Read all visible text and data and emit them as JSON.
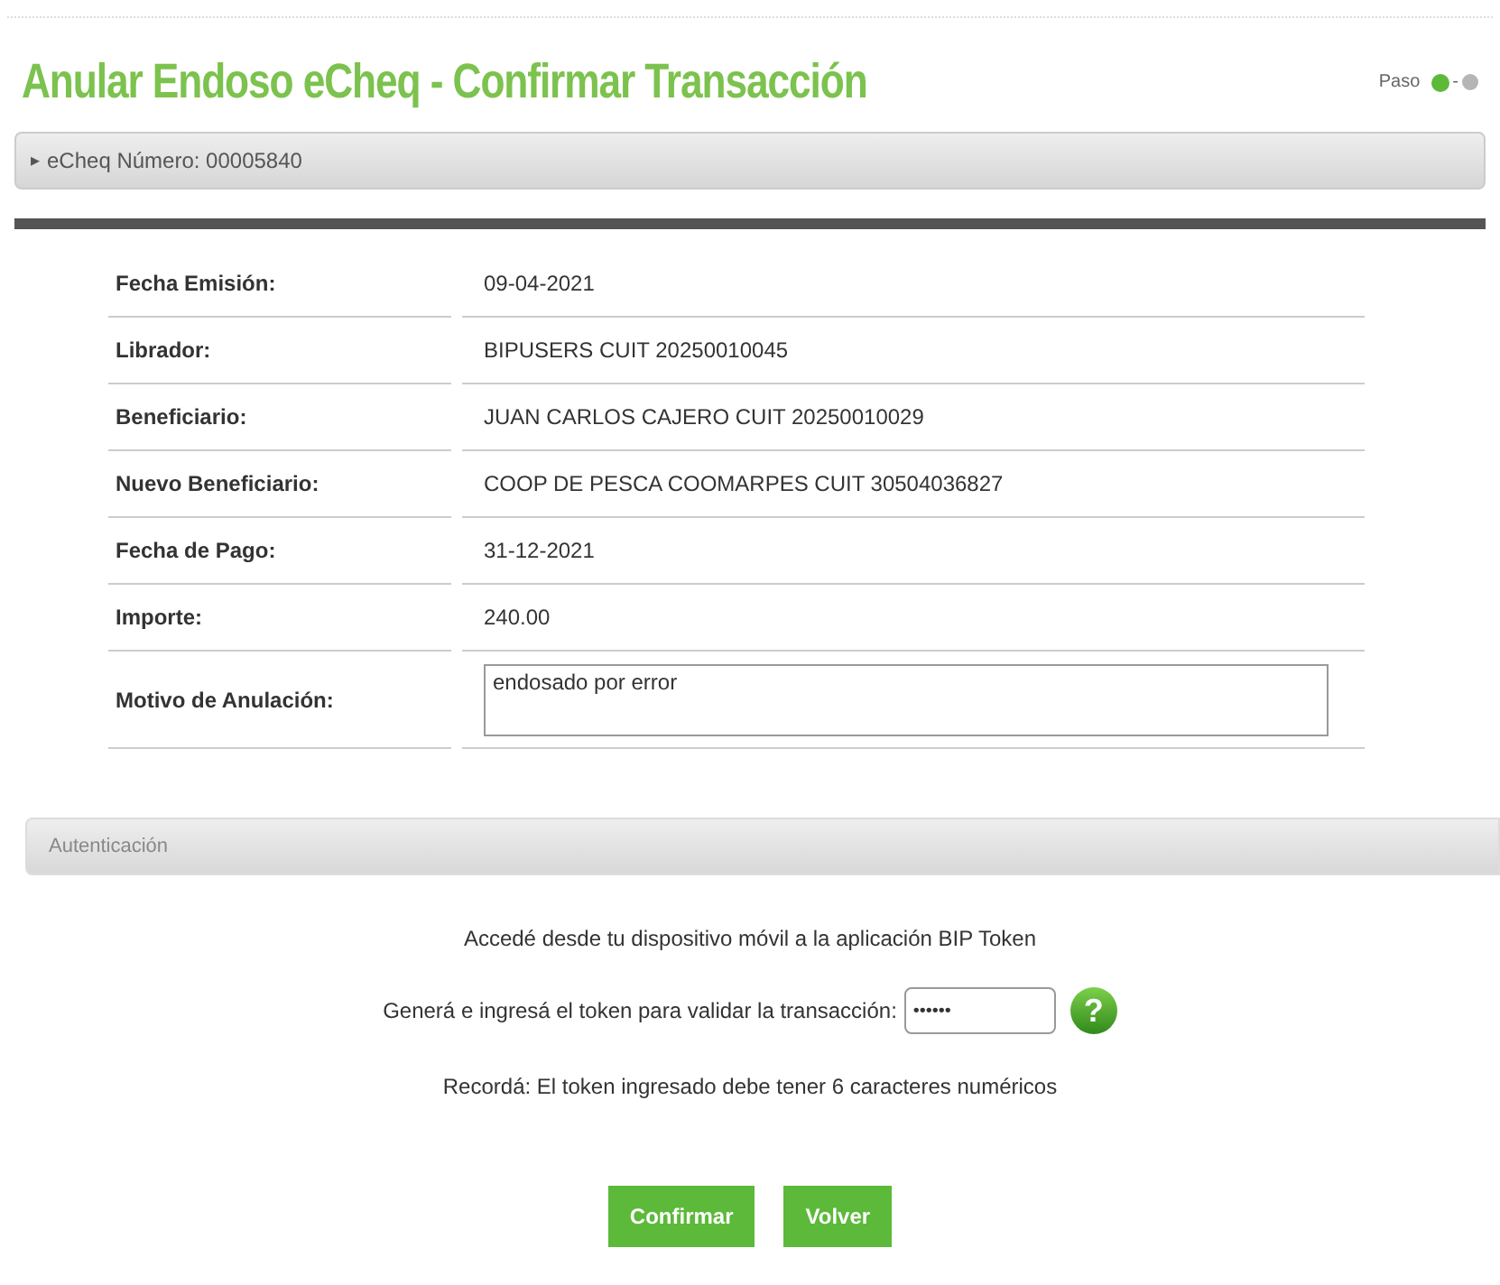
{
  "title": "Anular Endoso eCheq - Confirmar Transacción",
  "steps": {
    "label": "Paso",
    "separator": "-",
    "items": [
      {
        "selected": true
      },
      {
        "selected": false
      }
    ]
  },
  "echeq_bar": {
    "arrow": "▸",
    "label": "eCheq Número: 00005840"
  },
  "details": [
    {
      "label": "Fecha Emisión:",
      "value": "09-04-2021"
    },
    {
      "label": "Librador:",
      "value": "BIPUSERS CUIT 20250010045"
    },
    {
      "label": "Beneficiario:",
      "value": "JUAN CARLOS CAJERO CUIT 20250010029"
    },
    {
      "label": "Nuevo Beneficiario:",
      "value": "COOP DE PESCA COOMARPES CUIT 30504036827"
    },
    {
      "label": "Fecha de Pago:",
      "value": "31-12-2021"
    },
    {
      "label": "Importe:",
      "value": "240.00"
    },
    {
      "label": "Motivo de Anulación:",
      "value": "endosado por error",
      "kind": "field"
    }
  ],
  "auth": {
    "header": "Autenticación",
    "intro": "Accedé desde tu dispositivo móvil a la aplicación BIP Token",
    "token_label": "Generá e ingresá el token para validar la transacción:",
    "token_value": "••••••",
    "help": "?",
    "note": "Recordá: El token ingresado debe tener 6 caracteres numéricos"
  },
  "buttons": [
    "Confirmar",
    "Volver"
  ]
}
